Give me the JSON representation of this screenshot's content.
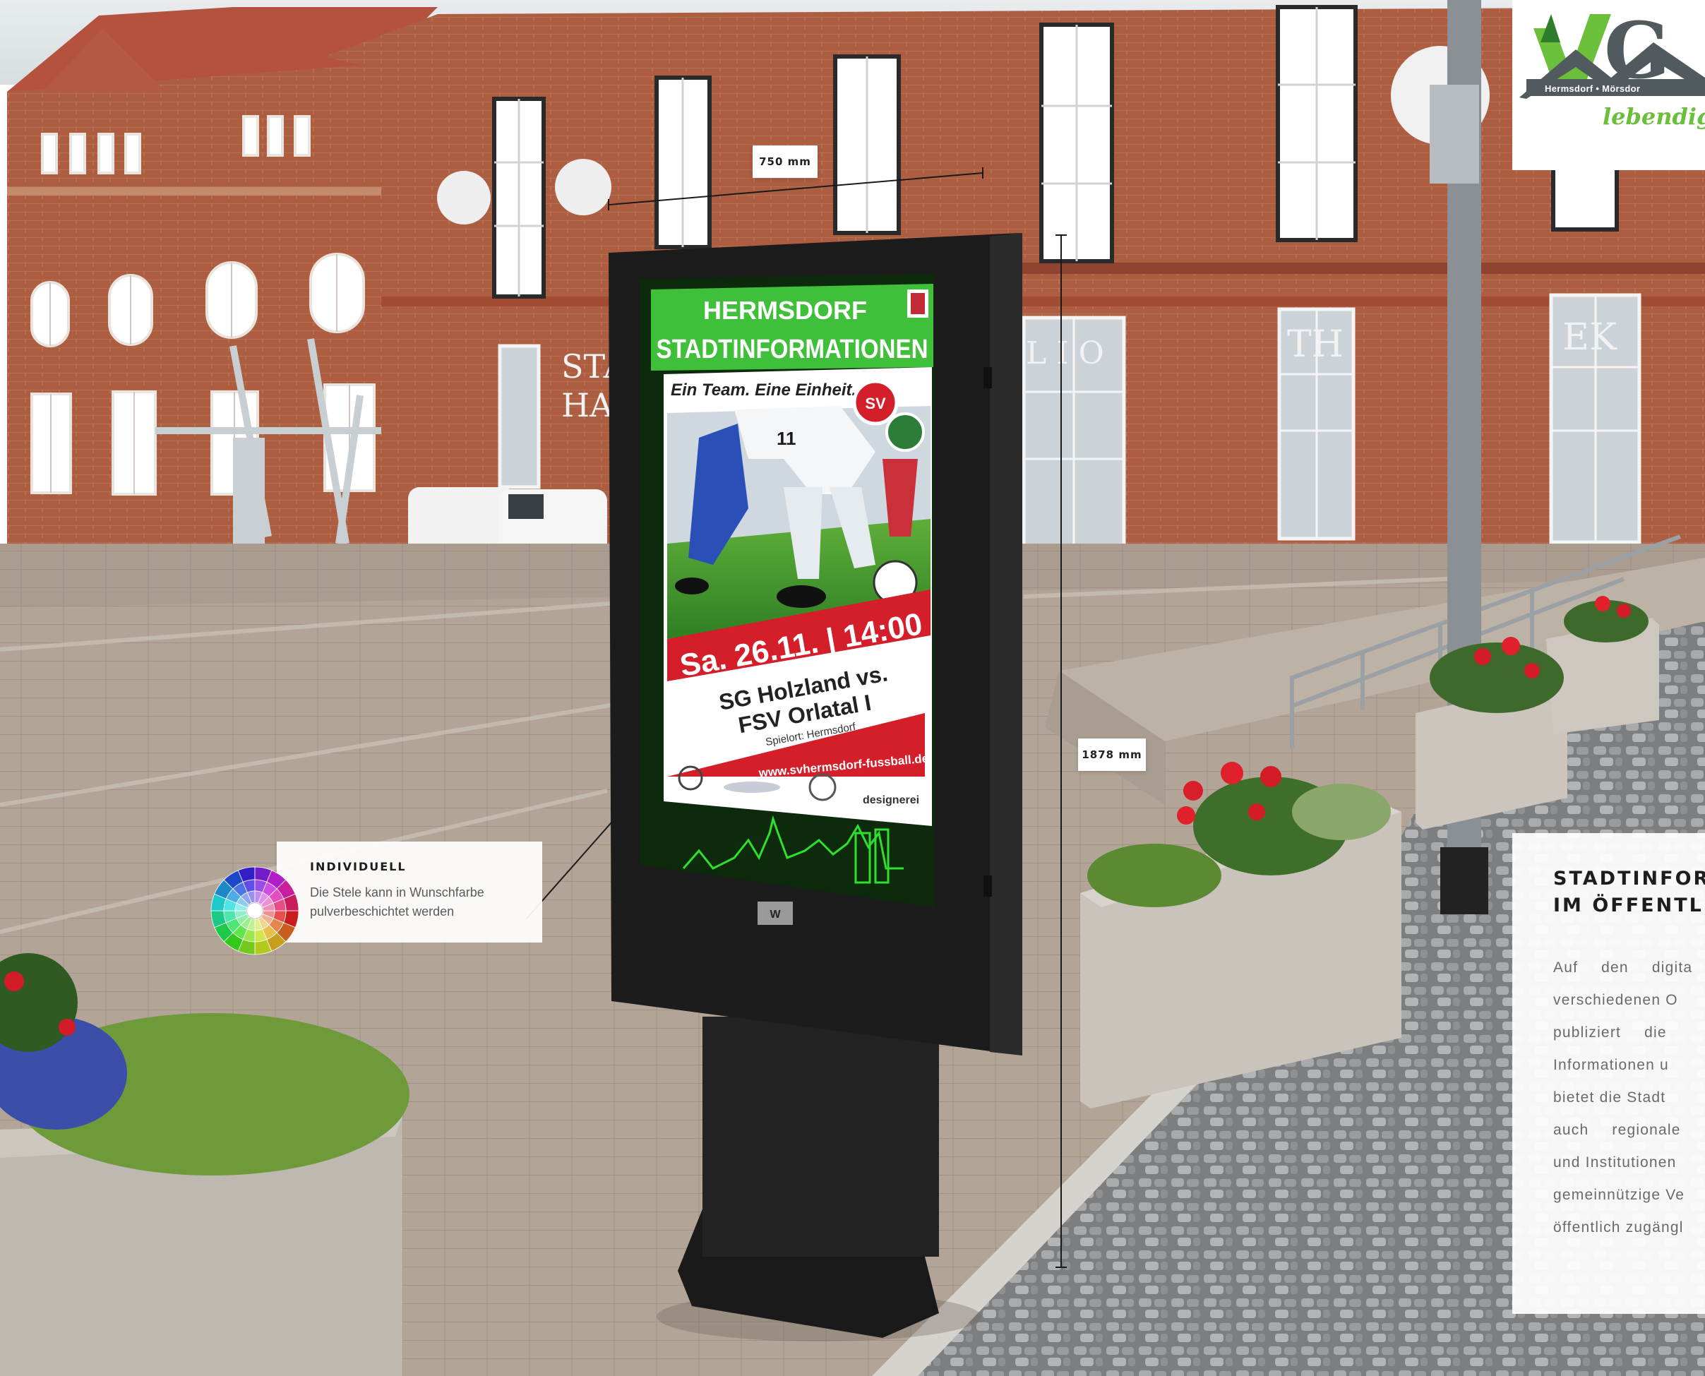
{
  "dimension_labels": {
    "width": "750 mm",
    "height": "1878 mm"
  },
  "callout": {
    "title": "INDIVIDUELL",
    "text_lines": [
      "Die Stele kann in Wunschfarbe",
      "pulverbeschichtet werden"
    ]
  },
  "screen": {
    "header_line1": "HERMSDORF",
    "header_line2": "STADTINFORMATIONEN",
    "poster": {
      "slogan": "Ein Team. Eine Einheit.",
      "club_badge": "SV",
      "date_time": "Sa. 26.11. | 14:00",
      "match_line1": "SG Holzland vs.",
      "match_line2": "FSV Orlatal I",
      "venue": "Spielort: Hermsdorf",
      "url": "www.svhermsdorf-fussball.de",
      "sponsor": "designerei",
      "player_number": "11"
    },
    "brand_plate": "W"
  },
  "building_signs": {
    "stadthaus_1": "STAD",
    "stadthaus_2": "HAU",
    "bib_1": "L I O",
    "bib_2": "TH",
    "bib_3": "EK"
  },
  "logo": {
    "letters": "VG",
    "places": "Hermsdorf • Mörsdor",
    "slogan": "lebendig ·"
  },
  "info_panel": {
    "title_lines": [
      "STADTINFORMA",
      "IM ÖFFENTLICH"
    ],
    "body_lines": [
      "Auf den digita",
      "verschiedenen O",
      "publiziert die",
      "Informationen u",
      "bietet die Stadt",
      "auch regionale",
      "und Institutionen",
      "gemeinnützige Ve",
      "öffentlich zugängl"
    ]
  },
  "colors": {
    "brick": "#a85a3e",
    "paving": "#b8aa9c",
    "stele": "#1e1e1e",
    "screen_green": "#3fbf3a",
    "poster_red": "#d41f2a",
    "logo_green": "#6cbf3a"
  }
}
